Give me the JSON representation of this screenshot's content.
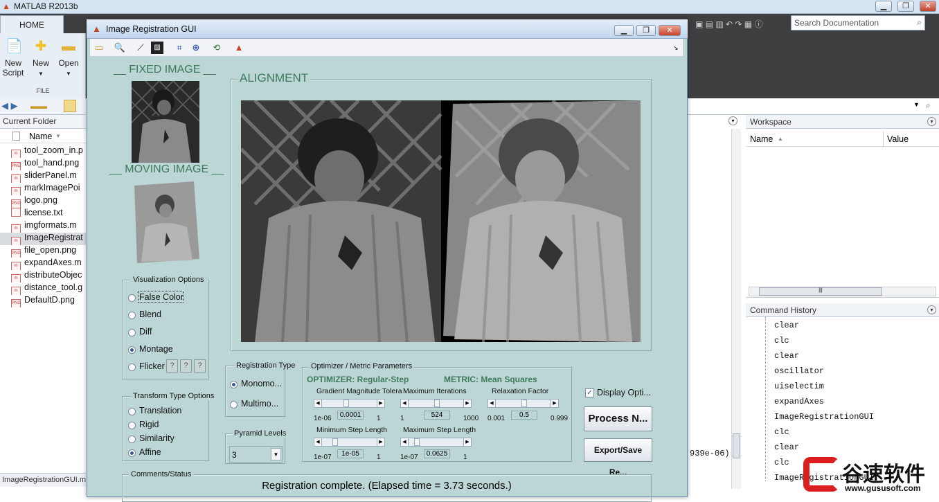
{
  "matlab": {
    "title": "MATLAB R2013b",
    "home_tab": "HOME",
    "buttons": {
      "new_script": "New\nScript",
      "new": "New",
      "open": "Open"
    },
    "file_group": "FILE",
    "search_placeholder": "Search Documentation",
    "current_folder": {
      "title": "Current Folder",
      "col_name": "Name",
      "files": [
        "tool_zoom_in.p",
        "tool_hand.png",
        "sliderPanel.m",
        "markImagePoi",
        "logo.png",
        "license.txt",
        "imgformats.m",
        "ImageRegistrat",
        "file_open.png",
        "expandAxes.m",
        "distributeObjec",
        "distance_tool.g",
        "DefaultD.png"
      ],
      "status": "ImageRegistrationGUI.m"
    },
    "workspace": {
      "title": "Workspace",
      "col_name": "Name",
      "col_value": "Value"
    },
    "command_history": {
      "title": "Command History",
      "entries": [
        "clear",
        "clc",
        "clear",
        "oscillator",
        "uiselectim",
        "expandAxes",
        "ImageRegistrationGUI",
        "clc",
        "clear",
        "clc",
        "ImageRegistrationGUI"
      ]
    },
    "command_window_fragment": "939e-06)"
  },
  "gui": {
    "title": "Image Registration GUI",
    "fixed_label": "__ FIXED IMAGE __",
    "moving_label": "__ MOVING IMAGE __",
    "alignment_label": "ALIGNMENT",
    "visualization": {
      "title": "Visualization Options",
      "options": [
        "False Color",
        "Blend",
        "Diff",
        "Montage",
        "Flicker"
      ],
      "selected": "Montage",
      "help": "?"
    },
    "transform": {
      "title": "Transform Type Options",
      "options": [
        "Translation",
        "Rigid",
        "Similarity",
        "Affine"
      ],
      "selected": "Affine"
    },
    "registration": {
      "title": "Registration Type",
      "options": [
        "Monomo...",
        "Multimo..."
      ],
      "selected": "Monomo..."
    },
    "pyramid": {
      "title": "Pyramid Levels",
      "value": "3"
    },
    "optimizer": {
      "title": "Optimizer / Metric Parameters",
      "optimizer_label": "OPTIMIZER: Regular-Step",
      "metric_label": "METRIC: Mean Squares",
      "params": [
        {
          "name": "Gradient Magnitude Tolera",
          "min": "1e-06",
          "value": "0.0001",
          "max": "1",
          "pos": 0.42
        },
        {
          "name": "Maximum Iterations",
          "min": "1",
          "value": "524",
          "max": "1000",
          "pos": 0.5
        },
        {
          "name": "Relaxation Factor",
          "min": "0.001",
          "value": "0.5",
          "max": "0.999",
          "pos": 0.5
        },
        {
          "name": "Minimum Step Length",
          "min": "1e-07",
          "value": "1e-05",
          "max": "1",
          "pos": 0.2
        },
        {
          "name": "Maximum Step Length",
          "min": "1e-07",
          "value": "0.0625",
          "max": "1",
          "pos": 0.1
        }
      ]
    },
    "display_options": {
      "label": "Display Opti...",
      "checked": true
    },
    "process_button": "Process N...",
    "export_button": "Export/Save Re...",
    "comments": {
      "title": "Comments/Status",
      "text": "Registration complete. (Elapsed time = 3.73 seconds.)"
    }
  },
  "watermark": {
    "brand": "谷速软件",
    "url": "www.gususoft.com"
  },
  "colors": {
    "gui_bg": "#bcd6d6",
    "label_green": "#3d7a5b",
    "ribbon_dark": "#3f3f41"
  }
}
